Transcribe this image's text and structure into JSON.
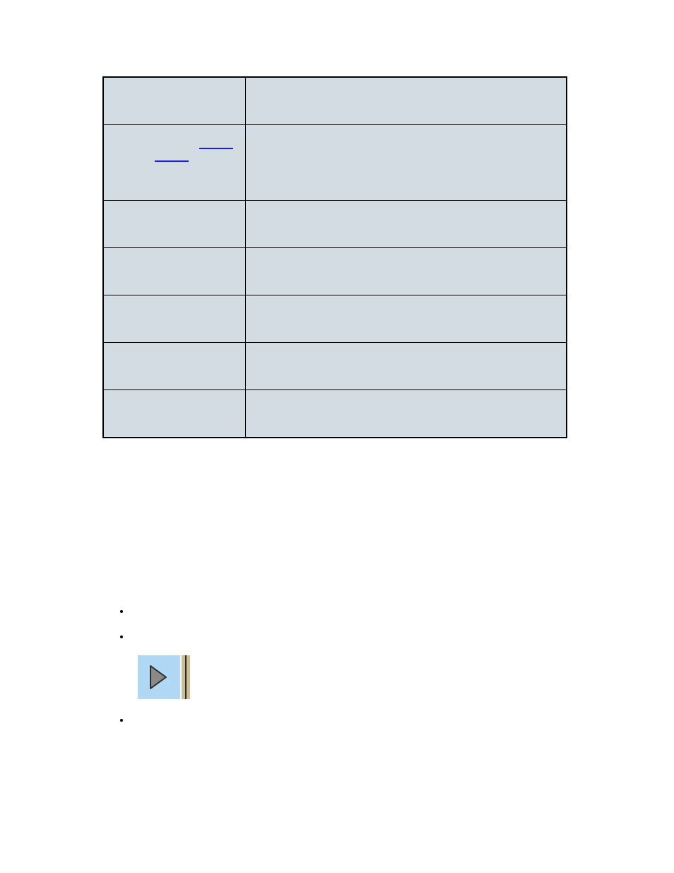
{
  "table": {
    "rows": [
      {
        "left": "",
        "right": ""
      },
      {
        "left": "",
        "right": ""
      },
      {
        "left": "",
        "right": ""
      },
      {
        "left": "",
        "right": ""
      },
      {
        "left": "",
        "right": ""
      },
      {
        "left": "",
        "right": ""
      },
      {
        "left": "",
        "right": ""
      }
    ]
  },
  "bullets": {
    "items": [
      "",
      "",
      ""
    ]
  },
  "icon_name": "go-to-end-icon"
}
